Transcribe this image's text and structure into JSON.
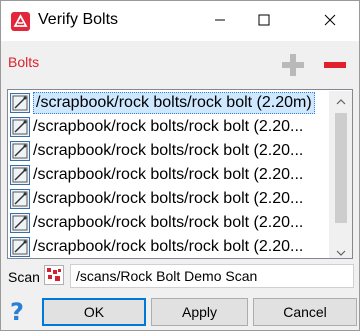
{
  "window": {
    "title": "Verify Bolts",
    "icons": {
      "app": "app-logo-icon",
      "minimize": "minimize-icon",
      "maximize": "maximize-icon",
      "close": "close-icon"
    },
    "accent": "#e0202c"
  },
  "bolts": {
    "label": "Bolts",
    "add_icon": "plus-icon",
    "remove_icon": "minus-icon",
    "items": [
      {
        "text": "/scrapbook/rock bolts/rock bolt (2.20m)",
        "selected": true
      },
      {
        "text": "/scrapbook/rock bolts/rock bolt (2.20...",
        "selected": false
      },
      {
        "text": "/scrapbook/rock bolts/rock bolt (2.20...",
        "selected": false
      },
      {
        "text": "/scrapbook/rock bolts/rock bolt (2.20...",
        "selected": false
      },
      {
        "text": "/scrapbook/rock bolts/rock bolt (2.20...",
        "selected": false
      },
      {
        "text": "/scrapbook/rock bolts/rock bolt (2.20...",
        "selected": false
      },
      {
        "text": "/scrapbook/rock bolts/rock bolt (2.20...",
        "selected": false
      }
    ]
  },
  "scan": {
    "label": "Scan",
    "icon": "scan-icon",
    "value": "/scans/Rock Bolt Demo Scan"
  },
  "buttons": {
    "help_icon": "help-icon",
    "help_glyph": "?",
    "ok": "OK",
    "apply": "Apply",
    "cancel": "Cancel"
  }
}
